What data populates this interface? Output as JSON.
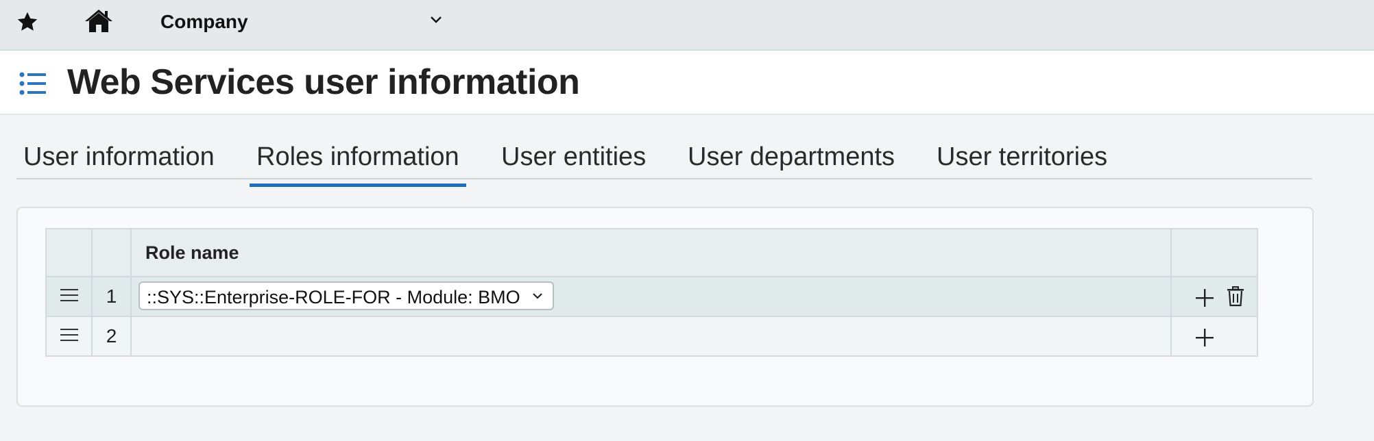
{
  "topbar": {
    "favorites_icon": "star-icon",
    "home_icon": "home-icon",
    "company_label": "Company",
    "company_dropdown_icon": "chevron-down-icon"
  },
  "page": {
    "menu_icon": "list-icon",
    "title": "Web Services user information"
  },
  "tabs": [
    {
      "label": "User information",
      "active": false
    },
    {
      "label": "Roles information",
      "active": true
    },
    {
      "label": "User entities",
      "active": false
    },
    {
      "label": "User departments",
      "active": false
    },
    {
      "label": "User territories",
      "active": false
    }
  ],
  "roles_table": {
    "columns": [
      "",
      "",
      "Role name",
      ""
    ],
    "rows": [
      {
        "number": "1",
        "role_name": "::SYS::Enterprise-ROLE-FOR - Module: BMO Sy",
        "selected": true,
        "actions": [
          "plus-icon",
          "trash-icon"
        ]
      },
      {
        "number": "2",
        "role_name": "",
        "selected": false,
        "actions": [
          "plus-icon"
        ]
      }
    ]
  },
  "colors": {
    "accent": "#1f6fba",
    "topbar_bg": "#e5e9ec",
    "selected_row_bg": "#e1ebec"
  }
}
